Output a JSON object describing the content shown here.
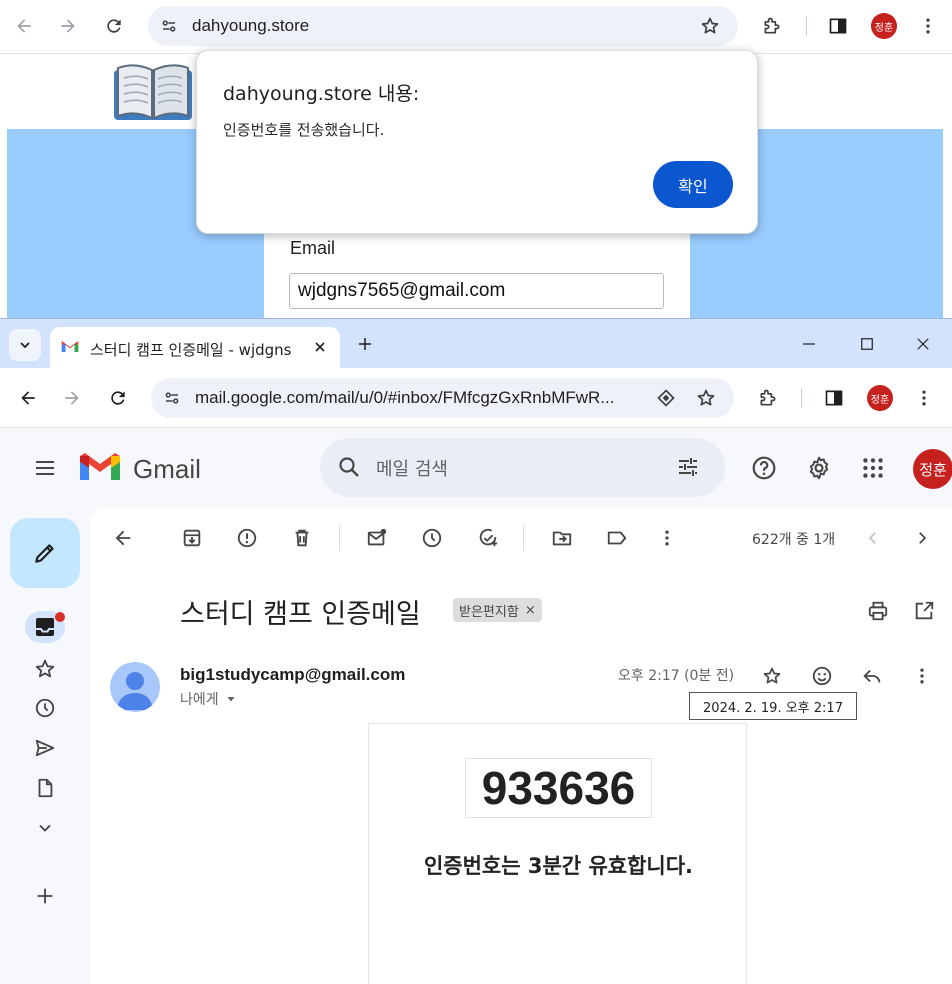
{
  "top_browser": {
    "url": "dahyoung.store",
    "profile_initials": "정훈"
  },
  "site": {
    "email_label": "Email",
    "email_value": "wjdgns7565@gmail.com"
  },
  "alert": {
    "title": "dahyoung.store 내용:",
    "message": "인증번호를 전송했습니다.",
    "ok_label": "확인"
  },
  "bottom_browser": {
    "tab_title": "스터디 캠프 인증메일 - wjdgns",
    "url": "mail.google.com/mail/u/0/#inbox/FMfcgzGxRnbMFwR...",
    "profile_initials": "정훈"
  },
  "gmail": {
    "wordmark": "Gmail",
    "search_placeholder": "메일 검색",
    "profile_initials": "정훈",
    "pager": "622개 중 1개",
    "subject": "스터디 캠프 인증메일",
    "label_chip": "받은편지함",
    "label_chip_close": "×",
    "sender": "big1studycamp@gmail.com",
    "recipient": "나에게",
    "time": "오후 2:17 (0분 전)",
    "tooltip_time": "2024. 2. 19. 오후 2:17",
    "verification_code": "933636",
    "validity_message": "인증번호는 3분간 유효합니다."
  },
  "colors": {
    "site_background": "#99ccff",
    "alert_button": "#0b57d0",
    "avatar": "#c5221f",
    "compose": "#c2e7ff",
    "tabstrip": "#d3e3fd"
  }
}
